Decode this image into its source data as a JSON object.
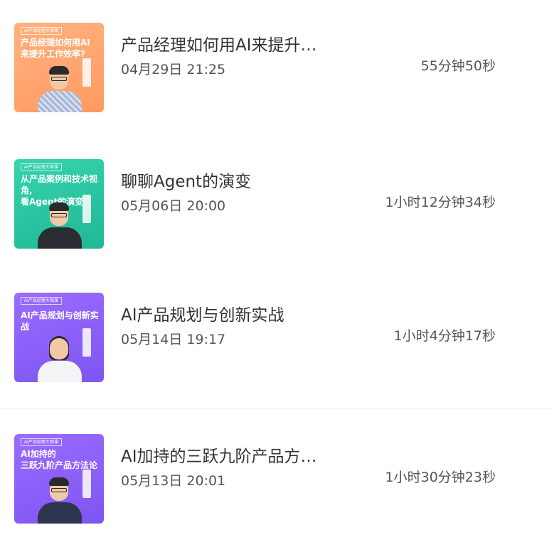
{
  "items": [
    {
      "thumb_tag": "AI产品经理大咖课",
      "thumb_title": "产品经理如何用AI\n来提升工作效率?",
      "title": "产品经理如何用AI来提升…",
      "time": "04月29日 21:25",
      "duration": "55分钟50秒"
    },
    {
      "thumb_tag": "AI产品经理大咖课",
      "thumb_title": "从产品案例和技术视角,\n看Agent的演变",
      "title": "聊聊Agent的演变",
      "time": "05月06日 20:00",
      "duration": "1小时12分钟34秒"
    },
    {
      "thumb_tag": "AI产品经理大咖课",
      "thumb_title": "AI产品规划与创新实战",
      "title": "AI产品规划与创新实战",
      "time": "05月14日 19:17",
      "duration": "1小时4分钟17秒"
    },
    {
      "thumb_tag": "AI产品经理大咖课",
      "thumb_title": "AI加持的\n三跃九阶产品方法论",
      "title": "AI加持的三跃九阶产品方…",
      "time": "05月13日 20:01",
      "duration": "1小时30分钟23秒"
    }
  ]
}
